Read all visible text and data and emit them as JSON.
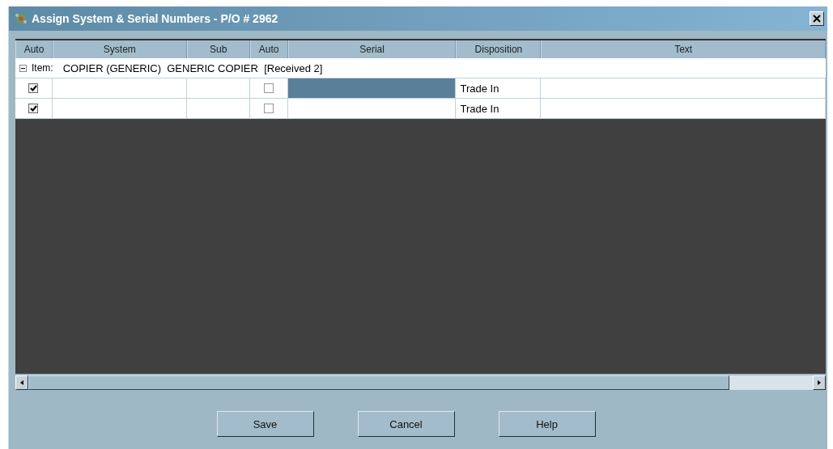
{
  "window": {
    "title": "Assign System & Serial Numbers - P/O # 2962"
  },
  "table": {
    "columns": [
      "Auto",
      "System",
      "Sub",
      "Auto",
      "Serial",
      "Disposition",
      "Text"
    ],
    "group": {
      "expanded": true,
      "label": "Item:",
      "text": "COPIER (GENERIC)  GENERIC COPIER  [Received 2]"
    },
    "rows": [
      {
        "auto": true,
        "auto_sub": false,
        "serial_selected": true,
        "disposition": "Trade In"
      },
      {
        "auto": true,
        "auto_sub": false,
        "serial_selected": false,
        "disposition": "Trade In"
      }
    ]
  },
  "buttons": [
    "Save",
    "Cancel",
    "Help"
  ]
}
